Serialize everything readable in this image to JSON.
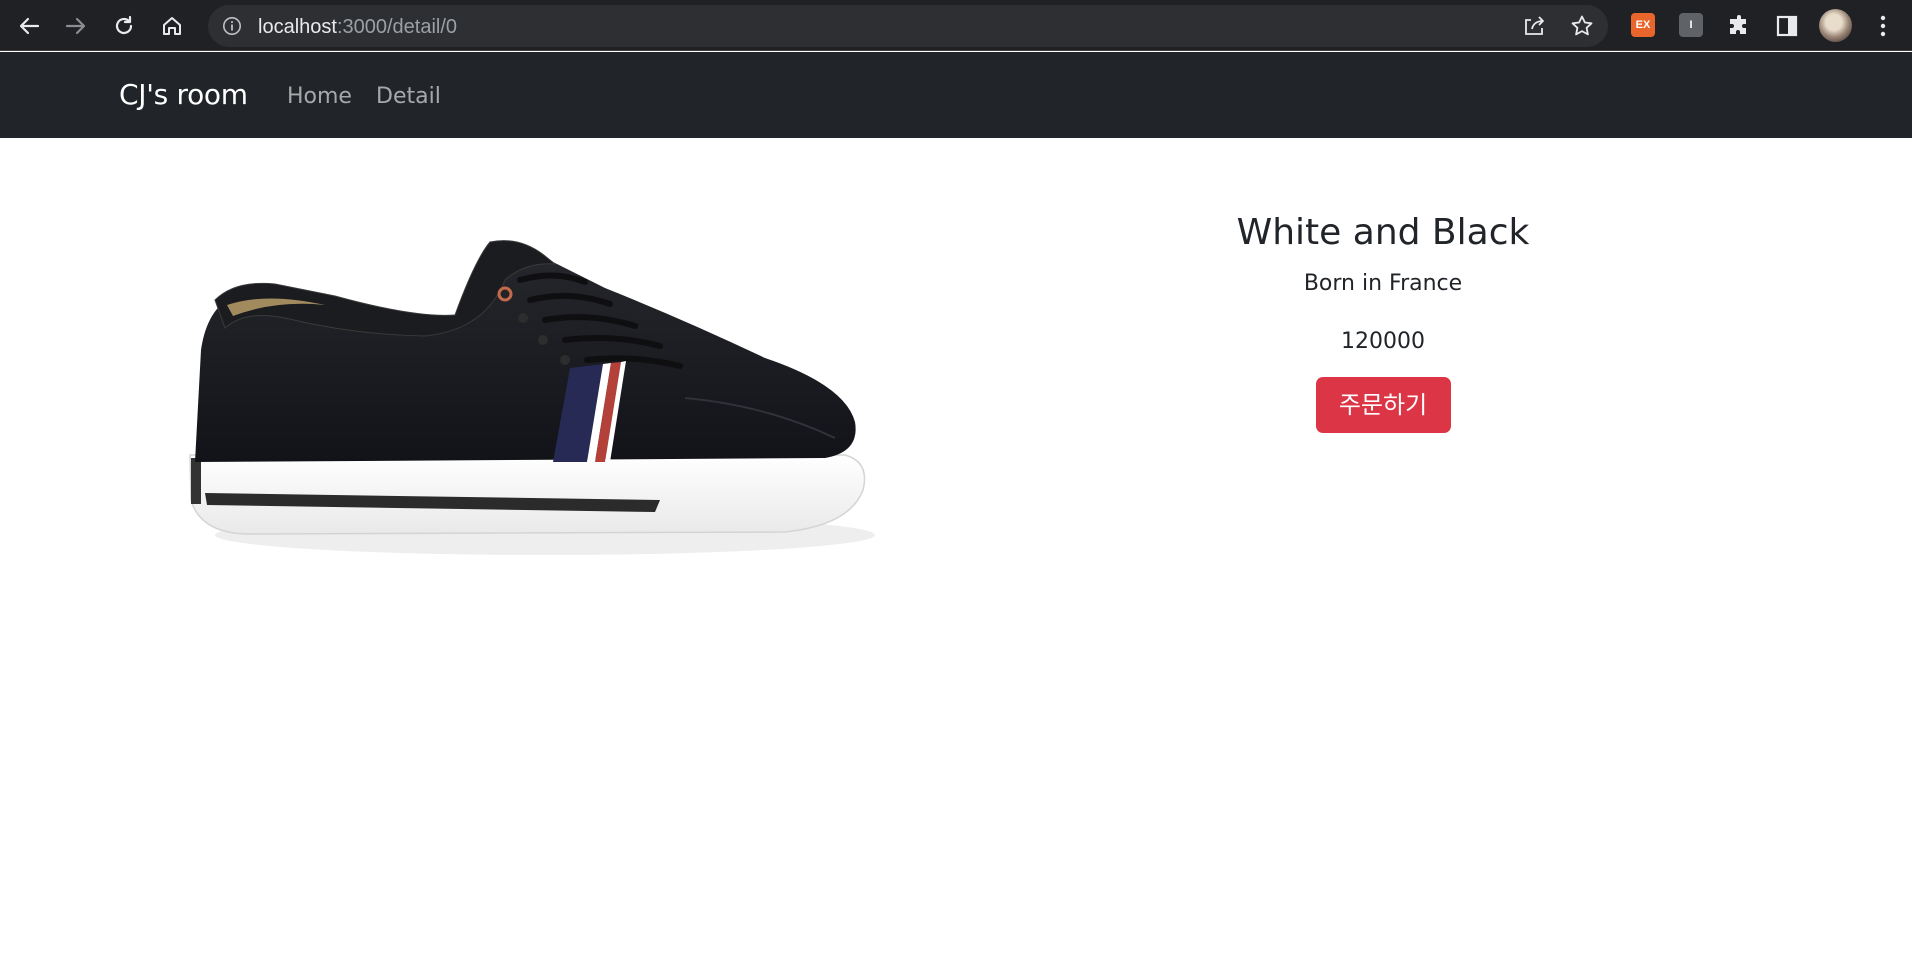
{
  "browser": {
    "url_host": "localhost",
    "url_path": ":3000/detail/0",
    "icons": [
      "back-arrow-icon",
      "forward-arrow-icon",
      "reload-icon",
      "home-icon",
      "site-info-icon",
      "share-icon",
      "bookmark-star-icon",
      "extension-ex-icon",
      "extension-i-icon",
      "puzzle-icon",
      "side-panel-icon",
      "profile-avatar",
      "kebab-menu-icon"
    ],
    "extensions": [
      {
        "label": "EX",
        "color": "#e8652b"
      },
      {
        "label": "I",
        "color": "#5f6368"
      }
    ]
  },
  "navbar": {
    "brand": "CJ's room",
    "links": [
      "Home",
      "Detail"
    ],
    "background": "#212529"
  },
  "product": {
    "title": "White and Black",
    "content": "Born in France",
    "price": "120000",
    "order_button": "주문하기",
    "button_color": "#dc3545"
  }
}
